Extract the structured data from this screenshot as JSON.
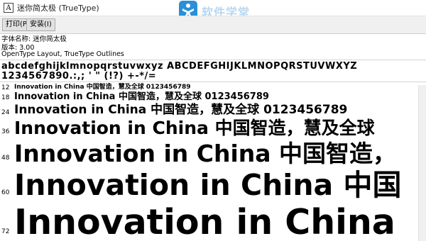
{
  "window": {
    "title": "迷你简太极 (TrueType)",
    "icon_glyph": "A",
    "watermark_text": "软件学堂"
  },
  "toolbar": {
    "print_label": "打印(P)",
    "install_label": "安装(I)"
  },
  "font_info": {
    "name_line": "字体名称: 迷你简太极",
    "version_line": "版本: 3.00",
    "features_line": "OpenType Layout, TrueType Outlines"
  },
  "charset": {
    "line1": "abcdefghijklmnopqrstuvwxyz ABCDEFGHIJKLMNOPQRSTUVWXYZ",
    "line2": "1234567890.:,; ' \" (!?) +-*/="
  },
  "samples": [
    {
      "size": "12",
      "text": "Innovation in China 中国智造，慧及全球 0123456789"
    },
    {
      "size": "18",
      "text": "Innovation in China 中国智造，慧及全球 0123456789"
    },
    {
      "size": "24",
      "text": "Innovation in China 中国智造，慧及全球 0123456789"
    },
    {
      "size": "36",
      "text": "Innovation in China 中国智造，慧及全球"
    },
    {
      "size": "48",
      "text": "Innovation in China 中国智造，"
    },
    {
      "size": "60",
      "text": "Innovation in China 中国"
    },
    {
      "size": "72",
      "text": "Innovation in China"
    }
  ]
}
